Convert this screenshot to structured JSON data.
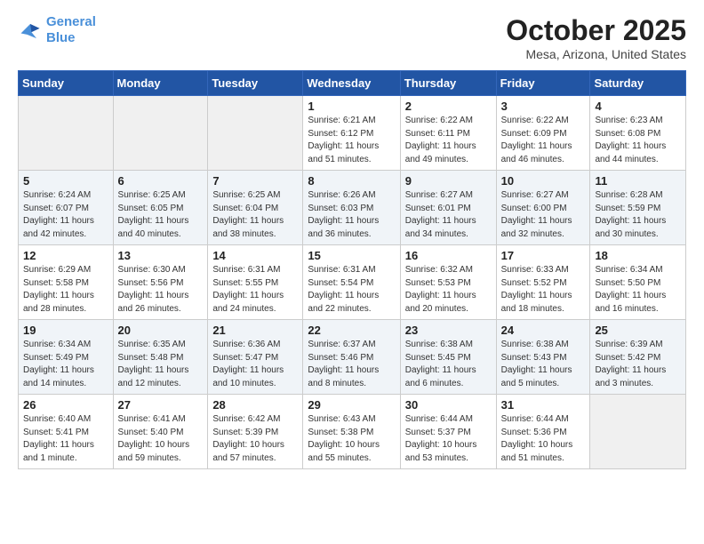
{
  "header": {
    "logo_line1": "General",
    "logo_line2": "Blue",
    "title": "October 2025",
    "subtitle": "Mesa, Arizona, United States"
  },
  "weekdays": [
    "Sunday",
    "Monday",
    "Tuesday",
    "Wednesday",
    "Thursday",
    "Friday",
    "Saturday"
  ],
  "weeks": [
    [
      {
        "day": "",
        "info": ""
      },
      {
        "day": "",
        "info": ""
      },
      {
        "day": "",
        "info": ""
      },
      {
        "day": "1",
        "info": "Sunrise: 6:21 AM\nSunset: 6:12 PM\nDaylight: 11 hours\nand 51 minutes."
      },
      {
        "day": "2",
        "info": "Sunrise: 6:22 AM\nSunset: 6:11 PM\nDaylight: 11 hours\nand 49 minutes."
      },
      {
        "day": "3",
        "info": "Sunrise: 6:22 AM\nSunset: 6:09 PM\nDaylight: 11 hours\nand 46 minutes."
      },
      {
        "day": "4",
        "info": "Sunrise: 6:23 AM\nSunset: 6:08 PM\nDaylight: 11 hours\nand 44 minutes."
      }
    ],
    [
      {
        "day": "5",
        "info": "Sunrise: 6:24 AM\nSunset: 6:07 PM\nDaylight: 11 hours\nand 42 minutes."
      },
      {
        "day": "6",
        "info": "Sunrise: 6:25 AM\nSunset: 6:05 PM\nDaylight: 11 hours\nand 40 minutes."
      },
      {
        "day": "7",
        "info": "Sunrise: 6:25 AM\nSunset: 6:04 PM\nDaylight: 11 hours\nand 38 minutes."
      },
      {
        "day": "8",
        "info": "Sunrise: 6:26 AM\nSunset: 6:03 PM\nDaylight: 11 hours\nand 36 minutes."
      },
      {
        "day": "9",
        "info": "Sunrise: 6:27 AM\nSunset: 6:01 PM\nDaylight: 11 hours\nand 34 minutes."
      },
      {
        "day": "10",
        "info": "Sunrise: 6:27 AM\nSunset: 6:00 PM\nDaylight: 11 hours\nand 32 minutes."
      },
      {
        "day": "11",
        "info": "Sunrise: 6:28 AM\nSunset: 5:59 PM\nDaylight: 11 hours\nand 30 minutes."
      }
    ],
    [
      {
        "day": "12",
        "info": "Sunrise: 6:29 AM\nSunset: 5:58 PM\nDaylight: 11 hours\nand 28 minutes."
      },
      {
        "day": "13",
        "info": "Sunrise: 6:30 AM\nSunset: 5:56 PM\nDaylight: 11 hours\nand 26 minutes."
      },
      {
        "day": "14",
        "info": "Sunrise: 6:31 AM\nSunset: 5:55 PM\nDaylight: 11 hours\nand 24 minutes."
      },
      {
        "day": "15",
        "info": "Sunrise: 6:31 AM\nSunset: 5:54 PM\nDaylight: 11 hours\nand 22 minutes."
      },
      {
        "day": "16",
        "info": "Sunrise: 6:32 AM\nSunset: 5:53 PM\nDaylight: 11 hours\nand 20 minutes."
      },
      {
        "day": "17",
        "info": "Sunrise: 6:33 AM\nSunset: 5:52 PM\nDaylight: 11 hours\nand 18 minutes."
      },
      {
        "day": "18",
        "info": "Sunrise: 6:34 AM\nSunset: 5:50 PM\nDaylight: 11 hours\nand 16 minutes."
      }
    ],
    [
      {
        "day": "19",
        "info": "Sunrise: 6:34 AM\nSunset: 5:49 PM\nDaylight: 11 hours\nand 14 minutes."
      },
      {
        "day": "20",
        "info": "Sunrise: 6:35 AM\nSunset: 5:48 PM\nDaylight: 11 hours\nand 12 minutes."
      },
      {
        "day": "21",
        "info": "Sunrise: 6:36 AM\nSunset: 5:47 PM\nDaylight: 11 hours\nand 10 minutes."
      },
      {
        "day": "22",
        "info": "Sunrise: 6:37 AM\nSunset: 5:46 PM\nDaylight: 11 hours\nand 8 minutes."
      },
      {
        "day": "23",
        "info": "Sunrise: 6:38 AM\nSunset: 5:45 PM\nDaylight: 11 hours\nand 6 minutes."
      },
      {
        "day": "24",
        "info": "Sunrise: 6:38 AM\nSunset: 5:43 PM\nDaylight: 11 hours\nand 5 minutes."
      },
      {
        "day": "25",
        "info": "Sunrise: 6:39 AM\nSunset: 5:42 PM\nDaylight: 11 hours\nand 3 minutes."
      }
    ],
    [
      {
        "day": "26",
        "info": "Sunrise: 6:40 AM\nSunset: 5:41 PM\nDaylight: 11 hours\nand 1 minute."
      },
      {
        "day": "27",
        "info": "Sunrise: 6:41 AM\nSunset: 5:40 PM\nDaylight: 10 hours\nand 59 minutes."
      },
      {
        "day": "28",
        "info": "Sunrise: 6:42 AM\nSunset: 5:39 PM\nDaylight: 10 hours\nand 57 minutes."
      },
      {
        "day": "29",
        "info": "Sunrise: 6:43 AM\nSunset: 5:38 PM\nDaylight: 10 hours\nand 55 minutes."
      },
      {
        "day": "30",
        "info": "Sunrise: 6:44 AM\nSunset: 5:37 PM\nDaylight: 10 hours\nand 53 minutes."
      },
      {
        "day": "31",
        "info": "Sunrise: 6:44 AM\nSunset: 5:36 PM\nDaylight: 10 hours\nand 51 minutes."
      },
      {
        "day": "",
        "info": ""
      }
    ]
  ]
}
